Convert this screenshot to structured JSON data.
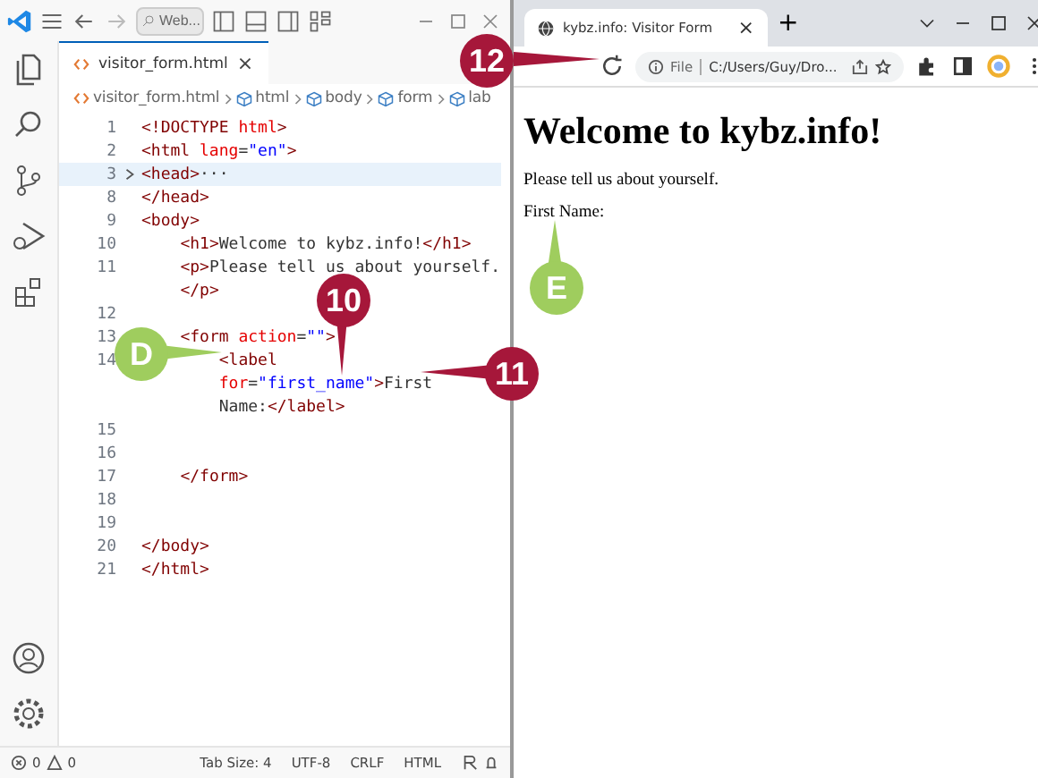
{
  "editor": {
    "search": {
      "placeholder": "Web..."
    },
    "tab": {
      "label": "visitor_form.html",
      "close": "×"
    },
    "breadcrumbs": [
      {
        "label": "visitor_form.html",
        "kind": "file"
      },
      {
        "label": "html",
        "kind": "element"
      },
      {
        "label": "body",
        "kind": "element"
      },
      {
        "label": "form",
        "kind": "element"
      },
      {
        "label": "lab",
        "kind": "element"
      }
    ],
    "lines": [
      {
        "number": "1",
        "folded": false,
        "highlighted": false,
        "rows": [
          {
            "tokens": [
              {
                "kind": "tag",
                "text": "<!DOCTYPE "
              },
              {
                "kind": "keyword",
                "text": "html"
              },
              {
                "kind": "tag",
                "text": ">"
              }
            ]
          }
        ]
      },
      {
        "number": "2",
        "folded": false,
        "highlighted": false,
        "rows": [
          {
            "tokens": [
              {
                "kind": "tag",
                "text": "<html "
              },
              {
                "kind": "attr",
                "text": "lang"
              },
              {
                "kind": "text",
                "text": "="
              },
              {
                "kind": "value",
                "text": "\"en\""
              },
              {
                "kind": "tag",
                "text": ">"
              }
            ]
          }
        ]
      },
      {
        "number": "3",
        "folded": true,
        "highlighted": true,
        "rows": [
          {
            "tokens": [
              {
                "kind": "tag",
                "text": "<head>"
              },
              {
                "kind": "text",
                "text": "···"
              }
            ]
          }
        ]
      },
      {
        "number": "8",
        "folded": false,
        "highlighted": false,
        "rows": [
          {
            "tokens": [
              {
                "kind": "tag",
                "text": "</head>"
              }
            ]
          }
        ]
      },
      {
        "number": "9",
        "folded": false,
        "highlighted": false,
        "rows": [
          {
            "tokens": [
              {
                "kind": "tag",
                "text": "<body>"
              }
            ]
          }
        ]
      },
      {
        "number": "10",
        "folded": false,
        "highlighted": false,
        "rows": [
          {
            "tokens": [
              {
                "kind": "tag",
                "text": "    <h1>"
              },
              {
                "kind": "text",
                "text": "Welcome to kybz.info!"
              },
              {
                "kind": "tag",
                "text": "</h1>"
              }
            ]
          }
        ]
      },
      {
        "number": "11",
        "folded": false,
        "highlighted": false,
        "rows": [
          {
            "tokens": [
              {
                "kind": "tag",
                "text": "    <p>"
              },
              {
                "kind": "text",
                "text": "Please tell us about yourself."
              }
            ]
          },
          {
            "tokens": [
              {
                "kind": "tag",
                "text": "    </p>"
              }
            ]
          }
        ]
      },
      {
        "number": "12",
        "folded": false,
        "highlighted": false,
        "rows": [
          {
            "tokens": []
          }
        ]
      },
      {
        "number": "13",
        "folded": false,
        "highlighted": false,
        "rows": [
          {
            "tokens": [
              {
                "kind": "tag",
                "text": "    <form "
              },
              {
                "kind": "attr",
                "text": "action"
              },
              {
                "kind": "text",
                "text": "="
              },
              {
                "kind": "value",
                "text": "\"\""
              },
              {
                "kind": "tag",
                "text": ">"
              }
            ]
          }
        ]
      },
      {
        "number": "14",
        "folded": false,
        "highlighted": false,
        "rows": [
          {
            "tokens": [
              {
                "kind": "tag",
                "text": "        <label"
              }
            ]
          },
          {
            "tokens": [
              {
                "kind": "attr",
                "text": "        for"
              },
              {
                "kind": "text",
                "text": "="
              },
              {
                "kind": "value",
                "text": "\"first_name\""
              },
              {
                "kind": "tag",
                "text": ">"
              },
              {
                "kind": "text",
                "text": "First"
              }
            ]
          },
          {
            "tokens": [
              {
                "kind": "text",
                "text": "        Name:"
              },
              {
                "kind": "tag",
                "text": "</label>"
              }
            ]
          }
        ]
      },
      {
        "number": "15",
        "folded": false,
        "highlighted": false,
        "rows": [
          {
            "tokens": []
          }
        ]
      },
      {
        "number": "16",
        "folded": false,
        "highlighted": false,
        "rows": [
          {
            "tokens": []
          }
        ]
      },
      {
        "number": "17",
        "folded": false,
        "highlighted": false,
        "rows": [
          {
            "tokens": [
              {
                "kind": "tag",
                "text": "    </form>"
              }
            ]
          }
        ]
      },
      {
        "number": "18",
        "folded": false,
        "highlighted": false,
        "rows": [
          {
            "tokens": []
          }
        ]
      },
      {
        "number": "19",
        "folded": false,
        "highlighted": false,
        "rows": [
          {
            "tokens": []
          }
        ]
      },
      {
        "number": "20",
        "folded": false,
        "highlighted": false,
        "rows": [
          {
            "tokens": [
              {
                "kind": "tag",
                "text": "</body>"
              }
            ]
          }
        ]
      },
      {
        "number": "21",
        "folded": false,
        "highlighted": false,
        "rows": [
          {
            "tokens": [
              {
                "kind": "tag",
                "text": "</html>"
              }
            ]
          }
        ]
      }
    ],
    "status_bar": {
      "errors": "0",
      "warnings": "0",
      "items": [
        "Tab Size: 4",
        "UTF-8",
        "CRLF",
        "HTML"
      ]
    }
  },
  "browser": {
    "tab": {
      "title": "kybz.info: Visitor Form",
      "close": "×"
    },
    "new_tab": "+",
    "address": {
      "scheme": "File",
      "url": "C:/Users/Guy/Dro..."
    },
    "page": {
      "heading": "Welcome to kybz.info!",
      "paragraph": "Please tell us about yourself.",
      "label": "First Name:"
    }
  },
  "callouts": [
    {
      "text": "12",
      "kind": "step"
    },
    {
      "text": "10",
      "kind": "step"
    },
    {
      "text": "11",
      "kind": "step"
    },
    {
      "text": "D",
      "kind": "letter"
    },
    {
      "text": "E",
      "kind": "letter"
    }
  ]
}
